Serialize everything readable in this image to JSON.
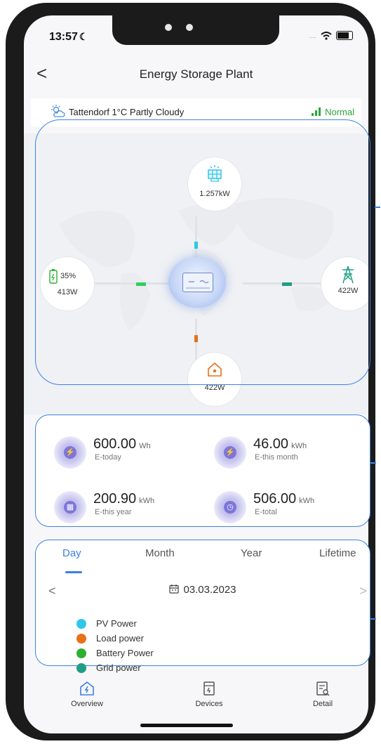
{
  "status_bar": {
    "time": "13:57",
    "moon": "☾",
    "signal": "....",
    "wifi": "wifi"
  },
  "header": {
    "title": "Energy Storage Plant",
    "back": "<"
  },
  "weather": {
    "location": "Tattendorf",
    "temp": "1°C",
    "condition": "Partly Cloudy",
    "status": "Normal"
  },
  "flow": {
    "pv": {
      "value": "1.257kW"
    },
    "battery": {
      "soc": "35%",
      "power": "413W"
    },
    "grid": {
      "power": "422W"
    },
    "load": {
      "power": "422W"
    }
  },
  "stats": [
    {
      "value": "600.00",
      "unit": "Wh",
      "label": "E-today"
    },
    {
      "value": "46.00",
      "unit": "kWh",
      "label": "E-this month"
    },
    {
      "value": "200.90",
      "unit": "kWh",
      "label": "E-this year"
    },
    {
      "value": "506.00",
      "unit": "kWh",
      "label": "E-total"
    }
  ],
  "chart": {
    "tabs": [
      "Day",
      "Month",
      "Year",
      "Lifetime"
    ],
    "active_tab": "Day",
    "date": "03.03.2023",
    "prev": "<",
    "next": ">",
    "legend": [
      {
        "label": "PV Power",
        "color": "#2ec7ea"
      },
      {
        "label": "Load power",
        "color": "#e8711a"
      },
      {
        "label": "Battery Power",
        "color": "#2fae2f"
      },
      {
        "label": "Grid power",
        "color": "#1f9e84"
      }
    ]
  },
  "nav": [
    {
      "label": "Overview"
    },
    {
      "label": "Devices"
    },
    {
      "label": "Detail"
    }
  ],
  "colors": {
    "accent": "#3b7de6",
    "normal": "#2aa63b",
    "frame": "#3b82e6"
  }
}
